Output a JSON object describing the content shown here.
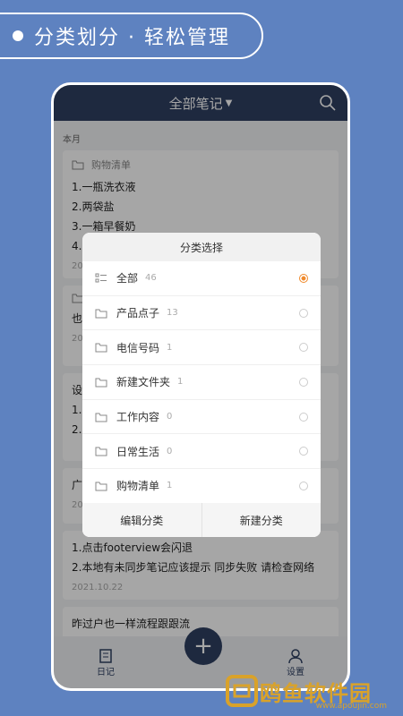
{
  "banner": {
    "text": "分类划分 · 轻松管理"
  },
  "app": {
    "title": "全部笔记",
    "section_label": "本月",
    "notes": [
      {
        "folder": "购物清单",
        "lines": [
          "1.一瓶洗衣液",
          "2.两袋盐",
          "3.一箱早餐奶",
          "4."
        ],
        "date": "20"
      },
      {
        "folder": "",
        "lines": [
          "也"
        ],
        "date": "20"
      },
      {
        "folder": "",
        "lines": [
          "设",
          "1.",
          "2."
        ],
        "date": "20"
      },
      {
        "folder": "",
        "lines": [
          "广"
        ],
        "date": "20"
      },
      {
        "folder": "",
        "lines": [
          "1.点击footerview会闪退",
          "2.本地有未同步笔记应该提示 同步失败 请检查网络"
        ],
        "date": "2021.10.22"
      },
      {
        "folder": "",
        "lines": [
          "昨过户也一样流程跟跟流"
        ],
        "date": ""
      }
    ],
    "tabs": {
      "notes_label": "日记",
      "settings_label": "设置"
    }
  },
  "dialog": {
    "title": "分类选择",
    "items": [
      {
        "name": "全部",
        "count": "46",
        "selected": true
      },
      {
        "name": "产品点子",
        "count": "13",
        "selected": false
      },
      {
        "name": "电信号码",
        "count": "1",
        "selected": false
      },
      {
        "name": "新建文件夹",
        "count": "1",
        "selected": false
      },
      {
        "name": "工作内容",
        "count": "0",
        "selected": false
      },
      {
        "name": "日常生活",
        "count": "0",
        "selected": false
      },
      {
        "name": "购物清单",
        "count": "1",
        "selected": false
      }
    ],
    "edit_label": "编辑分类",
    "new_label": "新建分类"
  },
  "watermark": {
    "text": "鸥鱼软件园",
    "sub": "www.apoujin.com"
  },
  "colors": {
    "background": "#5e82c0",
    "header": "#2e3f62",
    "accent": "#f08a2c"
  }
}
